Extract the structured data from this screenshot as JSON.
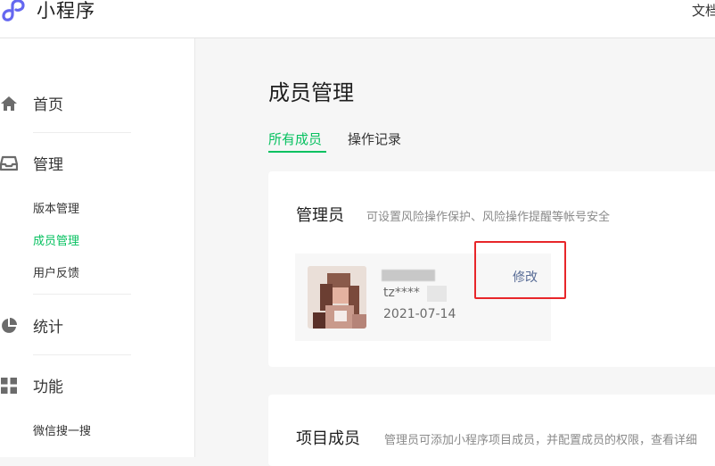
{
  "header": {
    "app_name": "小程序",
    "doc_link": "文档"
  },
  "sidebar": {
    "home": {
      "label": "首页",
      "icon": "home-icon"
    },
    "manage": {
      "label": "管理",
      "icon": "inbox-icon",
      "items": [
        "版本管理",
        "成员管理",
        "用户反馈"
      ]
    },
    "stats": {
      "label": "统计",
      "icon": "pie-chart-icon"
    },
    "features": {
      "label": "功能",
      "icon": "grid-icon",
      "items": [
        "微信搜一搜"
      ]
    }
  },
  "main": {
    "title": "成员管理",
    "tabs": [
      "所有成员",
      "操作记录"
    ],
    "admin_card": {
      "title": "管理员",
      "desc": "可设置风险操作保护、风险操作提醒等帐号安全",
      "member": {
        "id": "tz****",
        "date": "2021-07-14",
        "edit_label": "修改"
      }
    },
    "project_card": {
      "title": "项目成员",
      "desc": "管理员可添加小程序项目成员，并配置成员的权限，查看详细"
    }
  },
  "colors": {
    "accent": "#07c160",
    "link": "#576b95",
    "highlight": "#e8262a"
  }
}
